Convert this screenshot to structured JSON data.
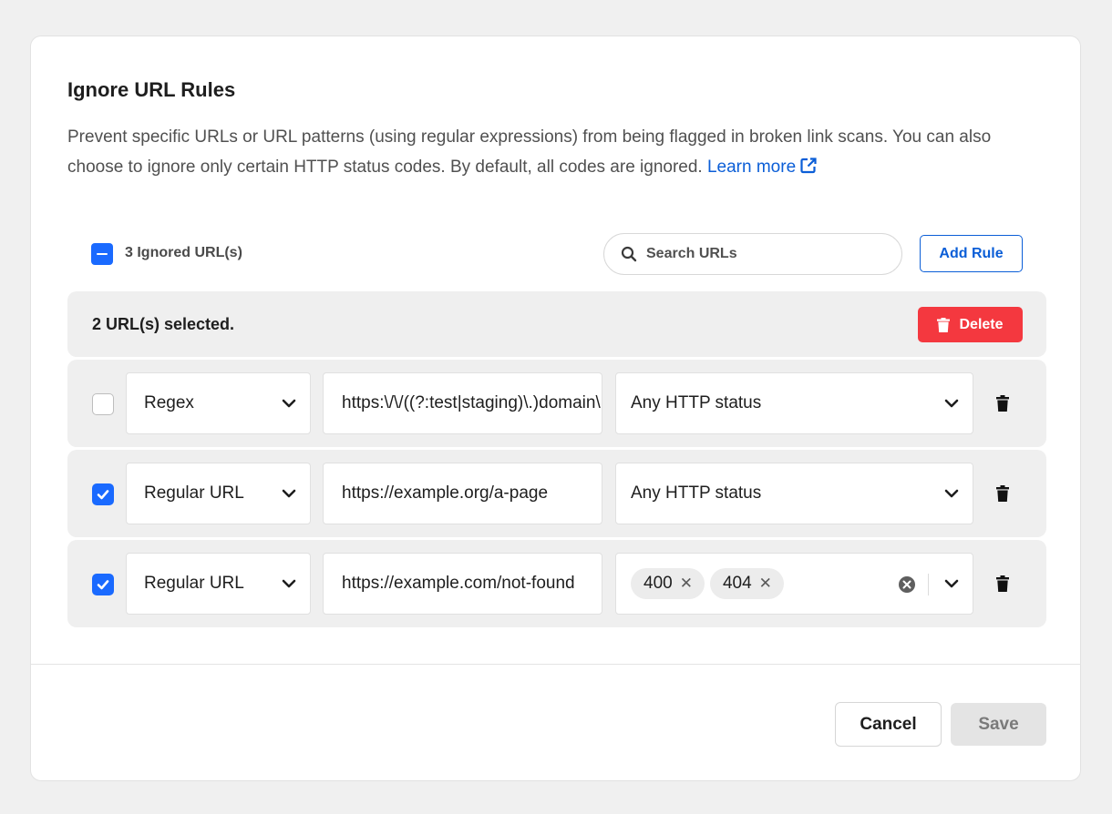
{
  "dialog": {
    "title": "Ignore URL Rules",
    "description": "Prevent specific URLs or URL patterns (using regular expressions) from being flagged in broken link scans. You can also choose to ignore only certain HTTP status codes. By default, all codes are ignored.",
    "learn_more": "Learn more"
  },
  "toolbar": {
    "count_label": "3 Ignored URL(s)",
    "search_placeholder": "Search URLs",
    "add_rule": "Add Rule"
  },
  "selection": {
    "text": "2 URL(s) selected.",
    "delete": "Delete"
  },
  "rules": [
    {
      "checked": false,
      "type": "Regex",
      "url": "https:\\/\\/((?:test|staging)\\.)domain\\.com",
      "status": "Any HTTP status",
      "codes": []
    },
    {
      "checked": true,
      "type": "Regular URL",
      "url": "https://example.org/a-page",
      "status": "Any HTTP status",
      "codes": []
    },
    {
      "checked": true,
      "type": "Regular URL",
      "url": "https://example.com/not-found",
      "status": "",
      "codes": [
        "400",
        "404"
      ]
    }
  ],
  "footer": {
    "cancel": "Cancel",
    "save": "Save"
  },
  "colors": {
    "accent": "#1a6aff",
    "link": "#0b5ed7",
    "danger": "#f4383f"
  }
}
